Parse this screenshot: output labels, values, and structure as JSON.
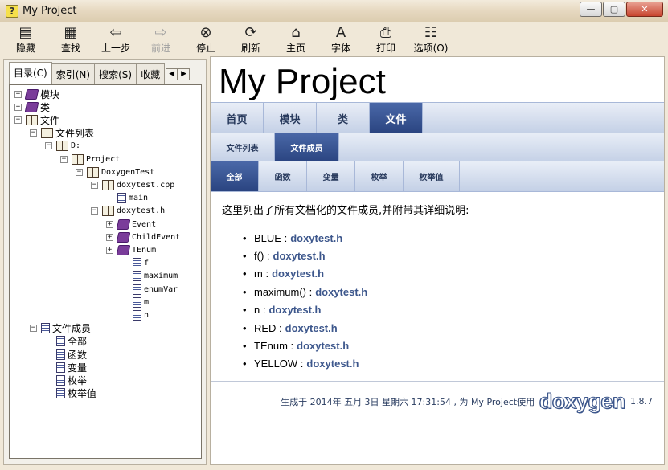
{
  "window": {
    "title": "My Project"
  },
  "toolbar": [
    {
      "key": "hide",
      "label": "隐藏",
      "icon": "hide-icon",
      "glyph": "▤",
      "enabled": true
    },
    {
      "key": "find",
      "label": "查找",
      "icon": "find-icon",
      "glyph": "▦",
      "enabled": true
    },
    {
      "key": "back",
      "label": "上一步",
      "icon": "back-arrow-icon",
      "glyph": "⇦",
      "enabled": true
    },
    {
      "key": "forward",
      "label": "前进",
      "icon": "forward-arrow-icon",
      "glyph": "⇨",
      "enabled": false
    },
    {
      "key": "stop",
      "label": "停止",
      "icon": "stop-icon",
      "glyph": "⊗",
      "enabled": true
    },
    {
      "key": "refresh",
      "label": "刷新",
      "icon": "refresh-icon",
      "glyph": "⟳",
      "enabled": true
    },
    {
      "key": "home",
      "label": "主页",
      "icon": "home-icon",
      "glyph": "⌂",
      "enabled": true
    },
    {
      "key": "font",
      "label": "字体",
      "icon": "font-icon",
      "glyph": "A",
      "enabled": true
    },
    {
      "key": "print",
      "label": "打印",
      "icon": "print-icon",
      "glyph": "⎙",
      "enabled": true
    },
    {
      "key": "options",
      "label": "选项(O)",
      "icon": "options-icon",
      "glyph": "☷",
      "enabled": true
    }
  ],
  "left_tabs": [
    {
      "label": "目录(C)",
      "active": true
    },
    {
      "label": "索引(N)",
      "active": false
    },
    {
      "label": "搜索(S)",
      "active": false
    },
    {
      "label": "收藏",
      "active": false
    }
  ],
  "tree": [
    {
      "label": "模块",
      "level": 0,
      "exp": "+",
      "icon": "book-closed",
      "mono": false
    },
    {
      "label": "类",
      "level": 0,
      "exp": "+",
      "icon": "book-closed",
      "mono": false
    },
    {
      "label": "文件",
      "level": 0,
      "exp": "−",
      "icon": "book-open",
      "mono": false
    },
    {
      "label": "文件列表",
      "level": 1,
      "exp": "−",
      "icon": "book-open",
      "mono": false
    },
    {
      "label": "D:",
      "level": 2,
      "exp": "−",
      "icon": "book-open",
      "mono": true
    },
    {
      "label": "Project",
      "level": 3,
      "exp": "−",
      "icon": "book-open",
      "mono": true
    },
    {
      "label": "DoxygenTest",
      "level": 4,
      "exp": "−",
      "icon": "book-open",
      "mono": true
    },
    {
      "label": "doxytest.cpp",
      "level": 5,
      "exp": "−",
      "icon": "book-open",
      "mono": true
    },
    {
      "label": "main",
      "level": 6,
      "exp": "",
      "icon": "page",
      "mono": true
    },
    {
      "label": "doxytest.h",
      "level": 5,
      "exp": "−",
      "icon": "book-open",
      "mono": true
    },
    {
      "label": "Event",
      "level": 6,
      "exp": "+",
      "icon": "book-closed",
      "mono": true
    },
    {
      "label": "ChildEvent",
      "level": 6,
      "exp": "+",
      "icon": "book-closed",
      "mono": true
    },
    {
      "label": "TEnum",
      "level": 6,
      "exp": "+",
      "icon": "book-closed",
      "mono": true
    },
    {
      "label": "f",
      "level": 7,
      "exp": "",
      "icon": "page",
      "mono": true
    },
    {
      "label": "maximum",
      "level": 7,
      "exp": "",
      "icon": "page",
      "mono": true
    },
    {
      "label": "enumVar",
      "level": 7,
      "exp": "",
      "icon": "page",
      "mono": true
    },
    {
      "label": "m",
      "level": 7,
      "exp": "",
      "icon": "page",
      "mono": true
    },
    {
      "label": "n",
      "level": 7,
      "exp": "",
      "icon": "page",
      "mono": true
    },
    {
      "label": "文件成员",
      "level": 1,
      "exp": "−",
      "icon": "page",
      "mono": false
    },
    {
      "label": "全部",
      "level": 2,
      "exp": "",
      "icon": "page",
      "mono": false
    },
    {
      "label": "函数",
      "level": 2,
      "exp": "",
      "icon": "page",
      "mono": false
    },
    {
      "label": "变量",
      "level": 2,
      "exp": "",
      "icon": "page",
      "mono": false
    },
    {
      "label": "枚举",
      "level": 2,
      "exp": "",
      "icon": "page",
      "mono": false
    },
    {
      "label": "枚举值",
      "level": 2,
      "exp": "",
      "icon": "page",
      "mono": false
    }
  ],
  "content": {
    "project_title": "My Project",
    "nav1": [
      {
        "label": "首页",
        "active": false
      },
      {
        "label": "模块",
        "active": false
      },
      {
        "label": "类",
        "active": false
      },
      {
        "label": "文件",
        "active": true
      }
    ],
    "nav2": [
      {
        "label": "文件列表",
        "active": false
      },
      {
        "label": "文件成员",
        "active": true
      }
    ],
    "nav3": [
      {
        "label": "全部",
        "active": true
      },
      {
        "label": "函数",
        "active": false
      },
      {
        "label": "变量",
        "active": false
      },
      {
        "label": "枚举",
        "active": false
      },
      {
        "label": "枚举值",
        "active": false
      }
    ],
    "intro": "这里列出了所有文档化的文件成员,并附带其详细说明:",
    "members": [
      {
        "name": "BLUE :",
        "file": "doxytest.h"
      },
      {
        "name": "f() :",
        "file": "doxytest.h"
      },
      {
        "name": "m :",
        "file": "doxytest.h"
      },
      {
        "name": "maximum() :",
        "file": "doxytest.h"
      },
      {
        "name": "n :",
        "file": "doxytest.h"
      },
      {
        "name": "RED :",
        "file": "doxytest.h"
      },
      {
        "name": "TEnum :",
        "file": "doxytest.h"
      },
      {
        "name": "YELLOW :",
        "file": "doxytest.h"
      }
    ],
    "footer": {
      "generated": "生成于 2014年 五月 3日 星期六 17:31:54 , 为 My Project使用",
      "logo": "doxygen",
      "version": "1.8.7"
    }
  }
}
